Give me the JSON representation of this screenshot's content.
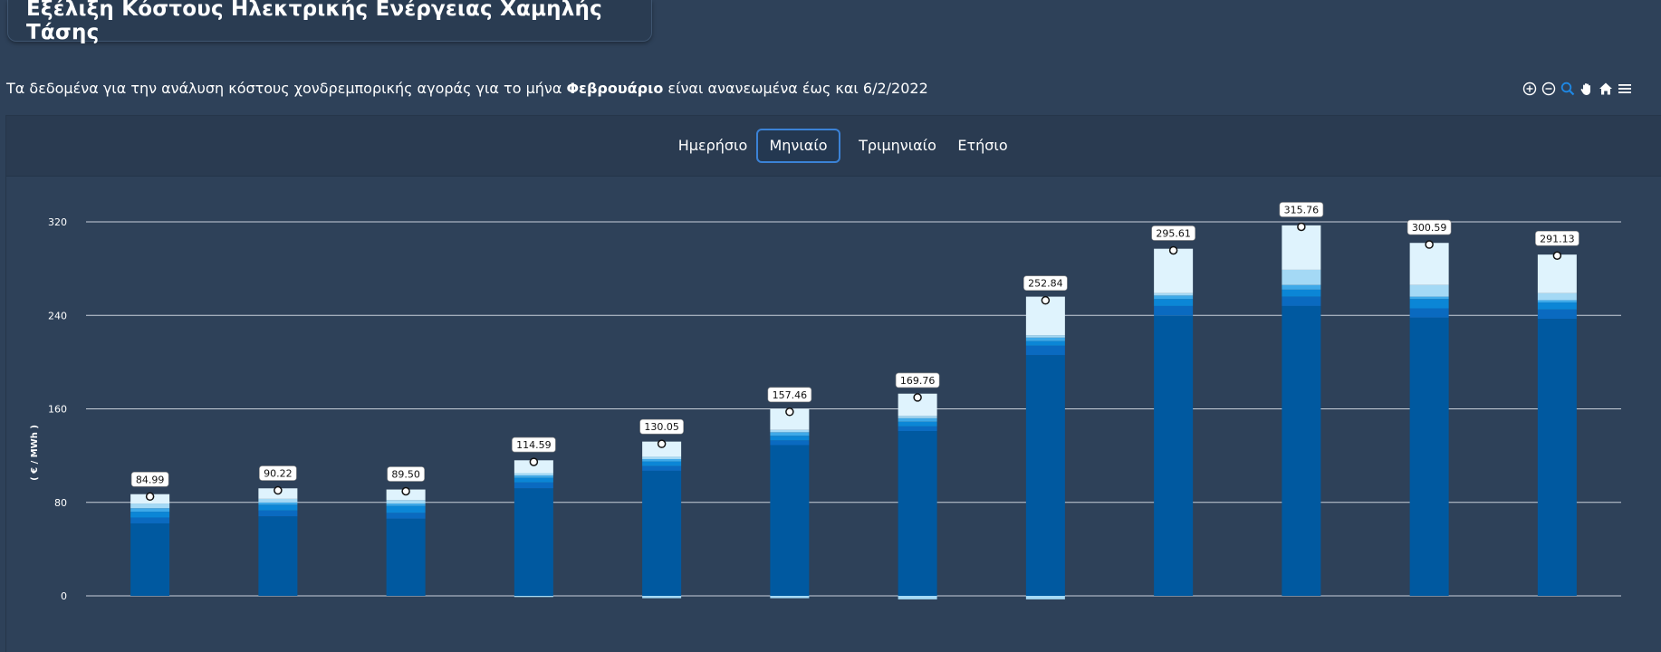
{
  "header": {
    "title": "Εξέλιξη Κόστους Ηλεκτρικής Ενέργειας Χαμηλής Τάσης"
  },
  "info": {
    "prefix": "Τα δεδομένα για την ανάλυση κόστους χονδρεμπορικής αγοράς για το μήνα ",
    "month": "Φεβρουάριο",
    "suffix": " είναι ανανεωμένα έως και 6/2/2022"
  },
  "tabs": [
    {
      "label": "Ημερήσιο",
      "active": false
    },
    {
      "label": "Μηνιαίο",
      "active": true
    },
    {
      "label": "Τριμηνιαίο",
      "active": false
    },
    {
      "label": "Ετήσιο",
      "active": false
    }
  ],
  "toolbar": {
    "icons": [
      "zoom-in-icon",
      "zoom-out-icon",
      "selection-zoom-icon",
      "pan-hand-icon",
      "home-reset-icon",
      "menu-icon"
    ]
  },
  "colors": {
    "series": [
      "#0059a0",
      "#0a6ac0",
      "#0b86d6",
      "#3ea9e8",
      "#a4d9f5",
      "#dff3fd"
    ],
    "negative": "#a4d9f5",
    "grid": "#c8d0da"
  },
  "chart_data": {
    "type": "bar",
    "stacked": true,
    "ylabel": "( € / MWh )",
    "ylim": [
      -4,
      320
    ],
    "yticks": [
      0,
      80,
      160,
      240,
      320
    ],
    "grid": true,
    "legend": "none",
    "totals": [
      84.99,
      90.22,
      89.5,
      114.59,
      130.05,
      157.46,
      169.76,
      252.84,
      295.61,
      315.76,
      300.59,
      291.13
    ],
    "total_labels": [
      "84.99",
      "90.22",
      "89.50",
      "114.59",
      "130.05",
      "157.46",
      "169.76",
      "252.84",
      "295.61",
      "315.76",
      "300.59",
      "291.13"
    ],
    "series": [
      {
        "values": [
          62,
          68,
          66,
          92,
          107,
          129,
          141,
          206,
          240,
          248,
          238,
          237
        ]
      },
      {
        "values": [
          5,
          5,
          5,
          5,
          4,
          4,
          4,
          8,
          8,
          8,
          8,
          8
        ]
      },
      {
        "values": [
          5,
          5,
          6,
          4,
          4,
          4,
          4,
          4,
          6,
          6,
          8,
          6
        ]
      },
      {
        "values": [
          3,
          2,
          2,
          2,
          2,
          3,
          3,
          3,
          3,
          4,
          2,
          2
        ]
      },
      {
        "values": [
          4,
          3,
          3,
          2,
          2,
          2,
          2,
          2,
          2,
          13,
          10,
          6
        ]
      },
      {
        "values": [
          8,
          9,
          9,
          11,
          13,
          18,
          19,
          33,
          38,
          38,
          36,
          33
        ]
      },
      {
        "values": [
          0,
          0,
          0,
          -1,
          -2,
          -2,
          -3,
          -3,
          0,
          0,
          0,
          0
        ]
      }
    ]
  }
}
